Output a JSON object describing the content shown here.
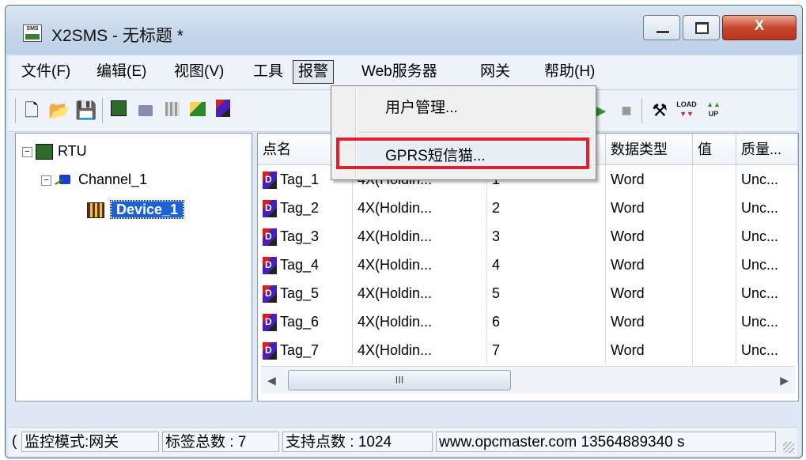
{
  "window": {
    "title": "X2SMS - 无标题 *",
    "app_icon_text": "SMS",
    "close_glyph": "X"
  },
  "menubar": {
    "items": [
      "文件(F)",
      "编辑(E)",
      "视图(V)",
      "工具",
      "报警",
      "Web服务器",
      "网关",
      "帮助(H)"
    ],
    "active": "报警"
  },
  "toolbar": {
    "icons": [
      "new-file-icon",
      "open-folder-icon",
      "save-icon",
      "rtu-icon",
      "channel-icon",
      "device-icon",
      "add-device-icon",
      "add-tag-icon",
      "play-icon",
      "stop-icon",
      "tools-icon",
      "load-icon",
      "upload-icon"
    ],
    "load_label": "LOAD",
    "up_label": "UP"
  },
  "tree": {
    "root": "RTU",
    "channel": "Channel_1",
    "device": "Device_1"
  },
  "table": {
    "columns": [
      "点名",
      "",
      "",
      "数据类型",
      "值",
      "质量..."
    ],
    "rows": [
      {
        "name": "Tag_1",
        "addr": "4X(Holdin...",
        "index": "1",
        "type": "Word",
        "value": "",
        "quality": "Unc..."
      },
      {
        "name": "Tag_2",
        "addr": "4X(Holdin...",
        "index": "2",
        "type": "Word",
        "value": "",
        "quality": "Unc..."
      },
      {
        "name": "Tag_3",
        "addr": "4X(Holdin...",
        "index": "3",
        "type": "Word",
        "value": "",
        "quality": "Unc..."
      },
      {
        "name": "Tag_4",
        "addr": "4X(Holdin...",
        "index": "4",
        "type": "Word",
        "value": "",
        "quality": "Unc..."
      },
      {
        "name": "Tag_5",
        "addr": "4X(Holdin...",
        "index": "5",
        "type": "Word",
        "value": "",
        "quality": "Unc..."
      },
      {
        "name": "Tag_6",
        "addr": "4X(Holdin...",
        "index": "6",
        "type": "Word",
        "value": "",
        "quality": "Unc..."
      },
      {
        "name": "Tag_7",
        "addr": "4X(Holdin...",
        "index": "7",
        "type": "Word",
        "value": "",
        "quality": "Unc..."
      }
    ],
    "scroll_thumb": "III"
  },
  "dropdown": {
    "items": [
      "用户管理...",
      "GPRS短信猫..."
    ],
    "highlighted": "GPRS短信猫...",
    "highlight_color": "#e0202a"
  },
  "statusbar": {
    "mode": "监控模式:网关",
    "tag_count": "标签总数 : 7",
    "support": "支持点数 : 1024",
    "site": "www.opcmaster.com 13564889340 s",
    "left_edge": "("
  },
  "colors": {
    "selection": "#1e61d6",
    "titlebar": "#c5d6ea"
  }
}
